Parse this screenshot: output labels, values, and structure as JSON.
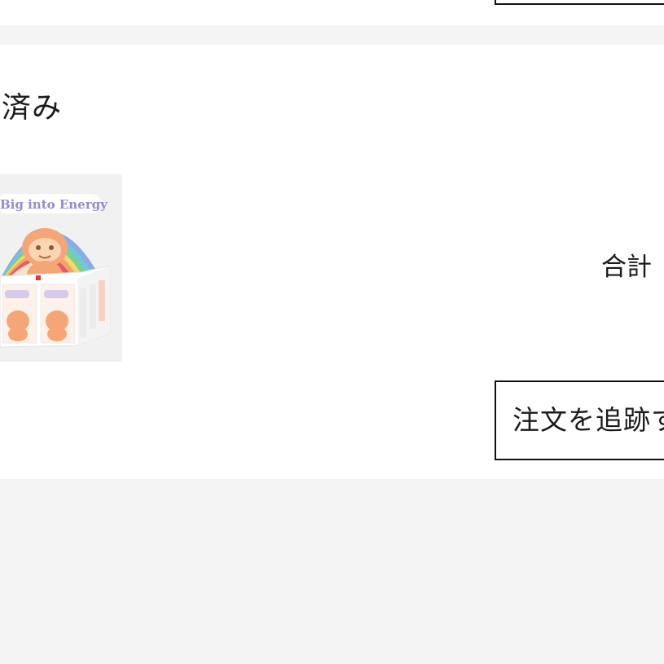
{
  "order": {
    "status_label": "済み",
    "total_label": "合計",
    "track_button_label": "注文を追跡す",
    "product_image": {
      "icon": "product-box-image",
      "title_text": "Big into Energy",
      "colors": {
        "background": "#f1f1f1",
        "figure": "#f6a676",
        "rainbow": [
          "#e85a6a",
          "#f2a36b",
          "#f3d66d",
          "#7fd08c",
          "#6ec8d8",
          "#8fa8e8"
        ]
      }
    }
  }
}
